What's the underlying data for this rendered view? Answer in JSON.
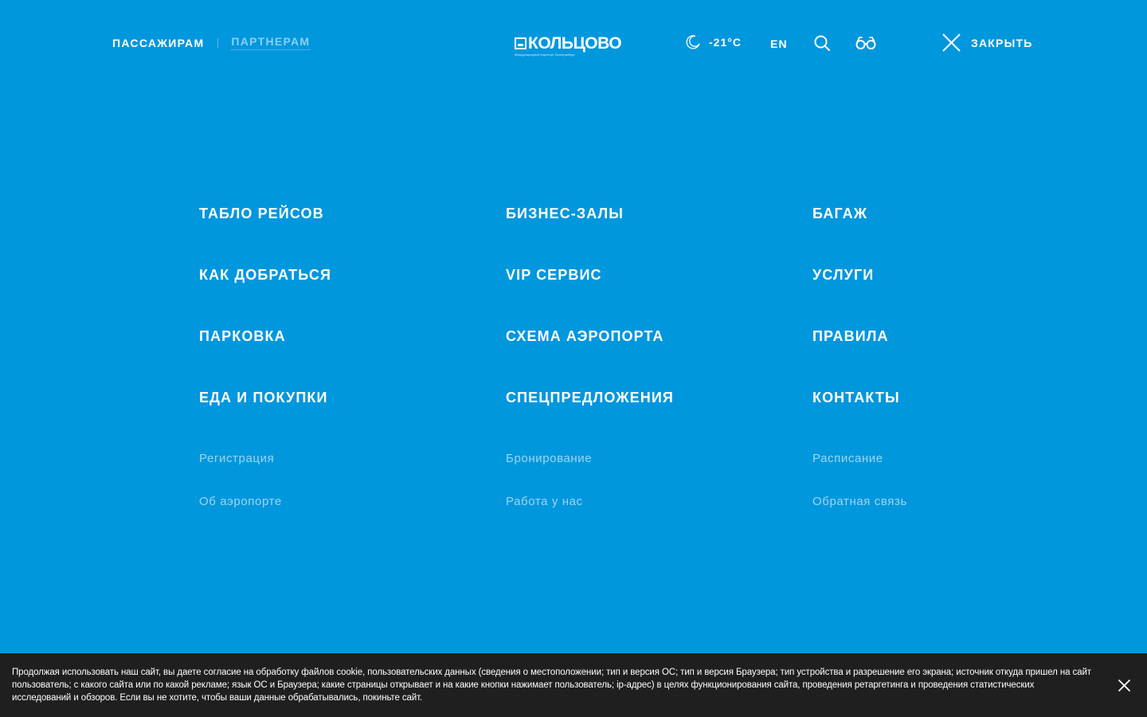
{
  "header": {
    "audience_tabs": [
      {
        "label": "ПАССАЖИРАМ",
        "active": true
      },
      {
        "label": "ПАРТНЕРАМ",
        "active": false
      }
    ],
    "logo": {
      "text": "КОЛЬЦОВО",
      "subtitle": "Международный Аэропорт Екатеринбург"
    },
    "weather": {
      "icon": "moon-icon",
      "temperature": "-21°C"
    },
    "language": "EN",
    "search_icon": "search-icon",
    "accessibility_icon": "glasses-icon",
    "close_label": "ЗАКРЫТЬ"
  },
  "menu": {
    "columns": [
      {
        "main": [
          "ТАБЛО РЕЙСОВ",
          "КАК ДОБРАТЬСЯ",
          "ПАРКОВКА",
          "ЕДА И ПОКУПКИ"
        ],
        "secondary": [
          "Регистрация",
          "Об аэропорте"
        ]
      },
      {
        "main": [
          "БИЗНЕС-ЗАЛЫ",
          "VIP СЕРВИС",
          "СХЕМА АЭРОПОРТА",
          "СПЕЦПРЕДЛОЖЕНИЯ"
        ],
        "secondary": [
          "Бронирование",
          "Работа у нас"
        ]
      },
      {
        "main": [
          "БАГАЖ",
          "УСЛУГИ",
          "ПРАВИЛА",
          "КОНТАКТЫ"
        ],
        "secondary": [
          "Расписание",
          "Обратная связь"
        ]
      }
    ]
  },
  "cookie_banner": {
    "text": "Продолжая использовать наш сайт, вы даете согласие на обработку файлов cookie, пользовательских данных (сведения о местоположении; тип и версия ОС; тип и версия Браузера; тип устройства и разрешение его экрана; источник откуда пришел на сайт пользователь; с какого сайта или по какой рекламе; язык ОС и Браузера; какие страницы открывает и на какие кнопки нажимает пользователь; ip-адрес) в целях функционирования сайта, проведения ретаргетинга и проведения статистических исследований и обзоров. Если вы не хотите, чтобы ваши данные обрабатывались, покиньте сайт.",
    "close_icon": "close-icon"
  },
  "colors": {
    "background": "#0197dd",
    "cookie_background": "#1f1f1f",
    "text": "#ffffff"
  }
}
